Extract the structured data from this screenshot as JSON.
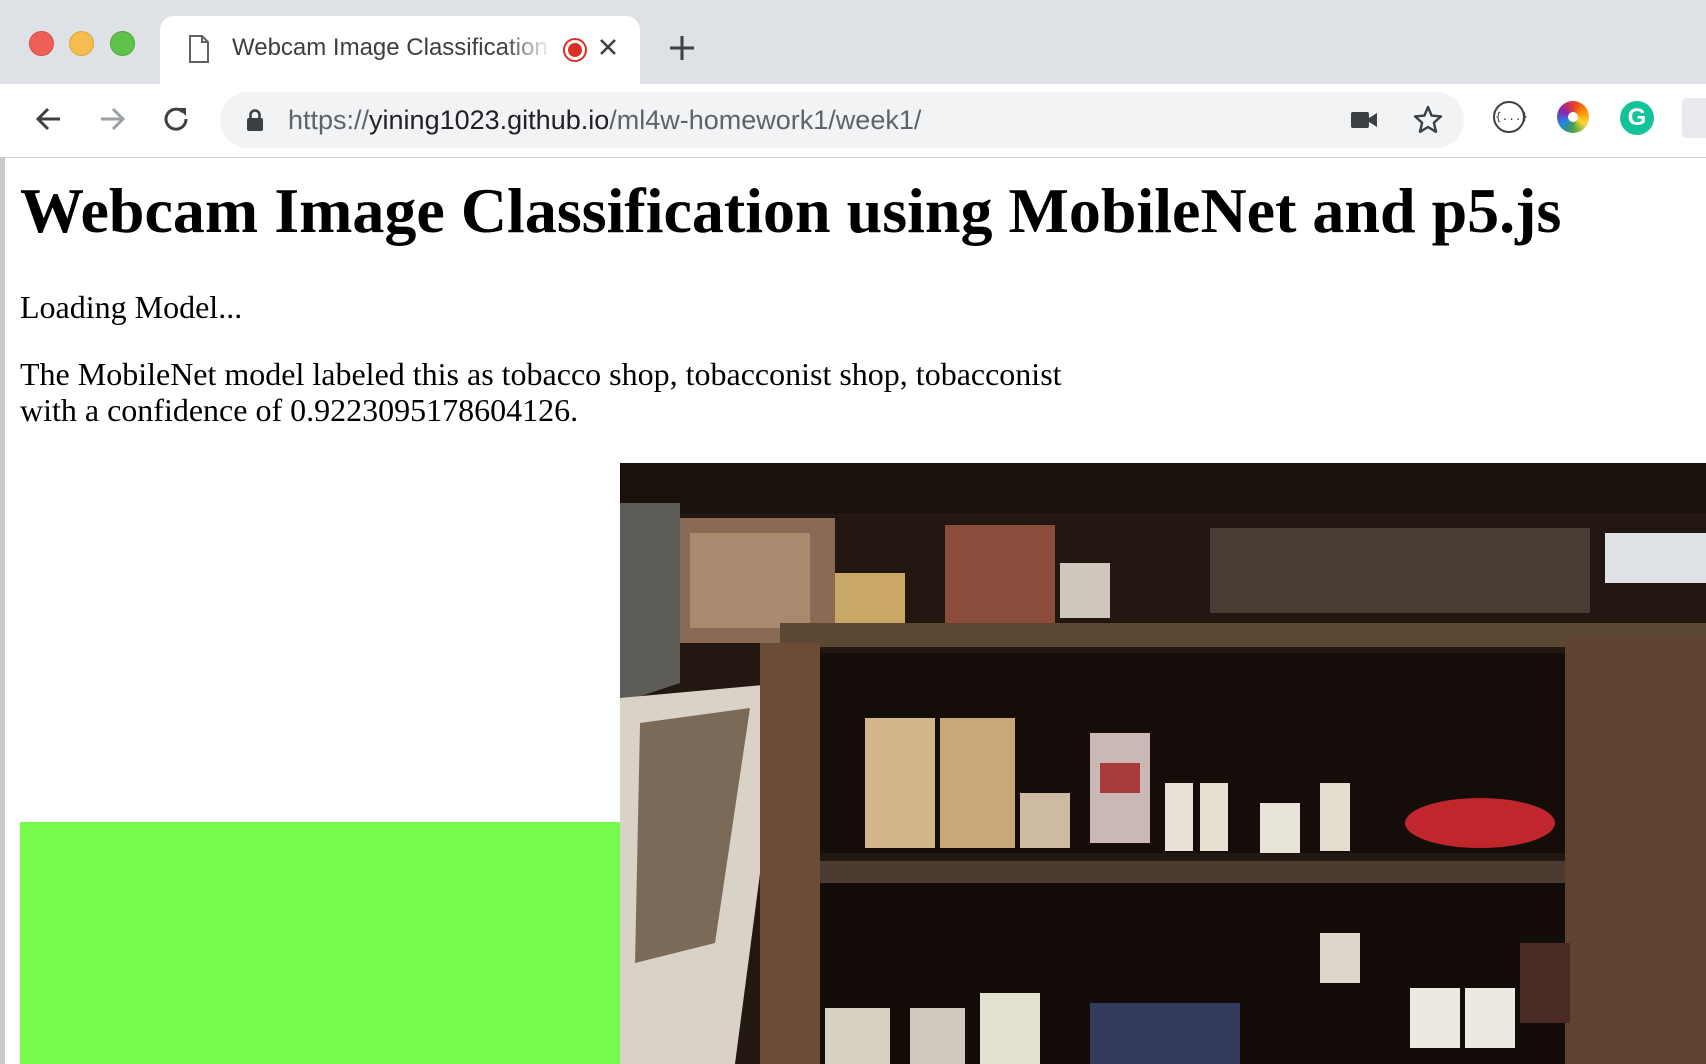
{
  "browser": {
    "tab": {
      "title": "Webcam Image Classification using MobileNet and p5.js",
      "doc_icon": "document-icon",
      "recording_icon": "recording-icon",
      "close_icon": "close-icon"
    },
    "new_tab_icon": "plus-icon",
    "nav": {
      "back_icon": "back-arrow-icon",
      "forward_icon": "forward-arrow-icon",
      "reload_icon": "reload-icon"
    },
    "address": {
      "scheme": "https://",
      "host": "yining1023.github.io",
      "path": "/ml4w-homework1/week1/",
      "lock_icon": "lock-icon",
      "camera_icon": "video-camera-icon",
      "bookmark_icon": "star-icon"
    },
    "extensions": {
      "json_label": "{...}",
      "grammarly_label": "G"
    }
  },
  "page": {
    "title": "Webcam Image Classification using MobileNet and p5.js",
    "status": "Loading Model...",
    "result_line1": "The MobileNet model labeled this as tobacco shop, tobacconist shop, tobacconist",
    "result_line2": "with a confidence of 0.9223095178604126."
  },
  "colors": {
    "green_box": "#76fb4c",
    "recording_red": "#d93025"
  }
}
